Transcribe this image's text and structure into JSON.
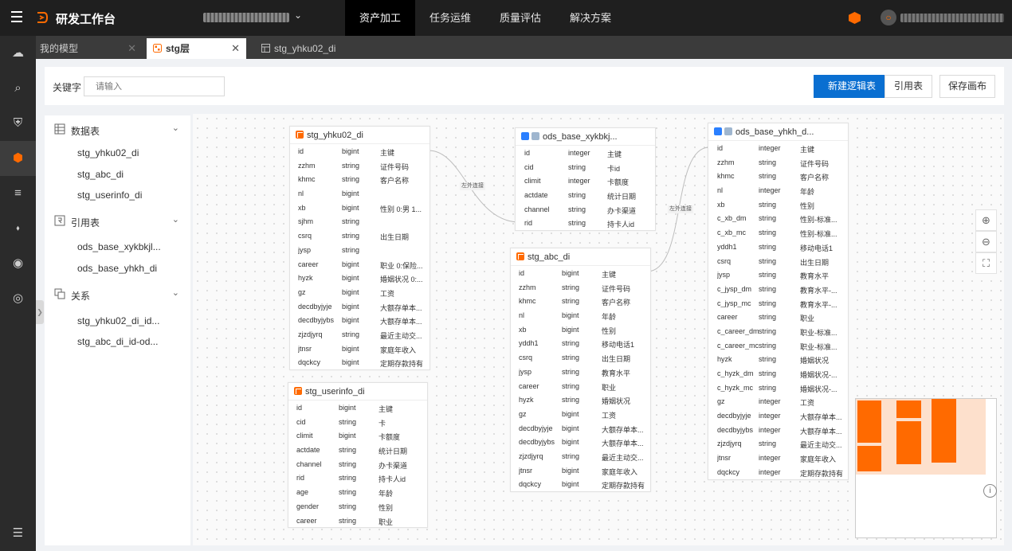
{
  "header": {
    "app_title": "研发工作台",
    "nav": [
      "资产加工",
      "任务运维",
      "质量评估",
      "解决方案"
    ],
    "active_nav": "资产加工"
  },
  "rail_icons": [
    "cloud-icon",
    "search-db-icon",
    "shield-icon",
    "cube-icon",
    "database-icon",
    "tag-icon",
    "api-icon",
    "globe-icon"
  ],
  "tabs": [
    {
      "label": "我的模型"
    },
    {
      "label": "stg层"
    },
    {
      "label": "stg_yhku02_di"
    }
  ],
  "filter": {
    "keyword_label": "关键字",
    "keyword_placeholder": "请输入",
    "btn_new_logic_table": "新建逻辑表",
    "btn_ref_table": "引用表",
    "btn_save_canvas": "保存画布"
  },
  "left_panel": {
    "groups": [
      {
        "label": "数据表",
        "items": [
          "stg_yhku02_di",
          "stg_abc_di",
          "stg_userinfo_di"
        ]
      },
      {
        "label": "引用表",
        "items": [
          "ods_base_xykbkjl...",
          "ods_base_yhkh_di"
        ]
      },
      {
        "label": "关系",
        "items": [
          "stg_yhku02_di_id...",
          "stg_abc_di_id-od..."
        ]
      }
    ]
  },
  "link_label": "左外连接",
  "tables": {
    "t1": {
      "title": "stg_yhku02_di",
      "rows": [
        [
          "id",
          "bigint",
          "主键"
        ],
        [
          "zzhm",
          "string",
          "证件号码"
        ],
        [
          "khmc",
          "string",
          "客户名称"
        ],
        [
          "nl",
          "bigint",
          ""
        ],
        [
          "xb",
          "bigint",
          "性别 0:男 1..."
        ],
        [
          "sjhm",
          "string",
          ""
        ],
        [
          "csrq",
          "string",
          "出生日期"
        ],
        [
          "jysp",
          "string",
          ""
        ],
        [
          "career",
          "bigint",
          "职业 0:保险..."
        ],
        [
          "hyzk",
          "bigint",
          "婚姻状况 0:..."
        ],
        [
          "gz",
          "bigint",
          "工资"
        ],
        [
          "decdbyjyje",
          "bigint",
          "大额存单本..."
        ],
        [
          "decdbyjybs",
          "bigint",
          "大额存单本..."
        ],
        [
          "zjzdjyrq",
          "string",
          "最近主动交..."
        ],
        [
          "jtnsr",
          "bigint",
          "家庭年收入"
        ],
        [
          "dqckcy",
          "bigint",
          "定期存款持有"
        ]
      ]
    },
    "t2": {
      "title": "stg_userinfo_di",
      "rows": [
        [
          "id",
          "bigint",
          "主键"
        ],
        [
          "cid",
          "string",
          "卡"
        ],
        [
          "climit",
          "bigint",
          "卡额度"
        ],
        [
          "actdate",
          "string",
          "统计日期"
        ],
        [
          "channel",
          "string",
          "办卡渠道"
        ],
        [
          "rid",
          "string",
          "持卡人id"
        ],
        [
          "age",
          "string",
          "年龄"
        ],
        [
          "gender",
          "string",
          "性别"
        ],
        [
          "career",
          "string",
          "职业"
        ]
      ]
    },
    "t3": {
      "title": "ods_base_xykbkj...",
      "rows": [
        [
          "id",
          "integer",
          "主键"
        ],
        [
          "cid",
          "string",
          "卡id"
        ],
        [
          "climit",
          "integer",
          "卡额度"
        ],
        [
          "actdate",
          "string",
          "统计日期"
        ],
        [
          "channel",
          "string",
          "办卡渠道"
        ],
        [
          "rid",
          "string",
          "持卡人id"
        ]
      ]
    },
    "t4": {
      "title": "stg_abc_di",
      "rows": [
        [
          "id",
          "bigint",
          "主键"
        ],
        [
          "zzhm",
          "string",
          "证件号码"
        ],
        [
          "khmc",
          "string",
          "客户名称"
        ],
        [
          "nl",
          "bigint",
          "年龄"
        ],
        [
          "xb",
          "bigint",
          "性别"
        ],
        [
          "yddh1",
          "string",
          "移动电话1"
        ],
        [
          "csrq",
          "string",
          "出生日期"
        ],
        [
          "jysp",
          "string",
          "教育水平"
        ],
        [
          "career",
          "string",
          "职业"
        ],
        [
          "hyzk",
          "string",
          "婚姻状况"
        ],
        [
          "gz",
          "bigint",
          "工资"
        ],
        [
          "decdbyjyje",
          "bigint",
          "大额存单本..."
        ],
        [
          "decdbyjybs",
          "bigint",
          "大额存单本..."
        ],
        [
          "zjzdjyrq",
          "string",
          "最近主动交..."
        ],
        [
          "jtnsr",
          "bigint",
          "家庭年收入"
        ],
        [
          "dqckcy",
          "bigint",
          "定期存款持有"
        ]
      ]
    },
    "t5": {
      "title": "ods_base_yhkh_d...",
      "rows": [
        [
          "id",
          "integer",
          "主键"
        ],
        [
          "zzhm",
          "string",
          "证件号码"
        ],
        [
          "khmc",
          "string",
          "客户名称"
        ],
        [
          "nl",
          "integer",
          "年龄"
        ],
        [
          "xb",
          "string",
          "性别"
        ],
        [
          "c_xb_dm",
          "string",
          "性别-标准..."
        ],
        [
          "c_xb_mc",
          "string",
          "性别-标准..."
        ],
        [
          "yddh1",
          "string",
          "移动电话1"
        ],
        [
          "csrq",
          "string",
          "出生日期"
        ],
        [
          "jysp",
          "string",
          "教育水平"
        ],
        [
          "c_jysp_dm",
          "string",
          "教育水平-..."
        ],
        [
          "c_jysp_mc",
          "string",
          "教育水平-..."
        ],
        [
          "career",
          "string",
          "职业"
        ],
        [
          "c_career_dm",
          "string",
          "职业-标准..."
        ],
        [
          "c_career_mc",
          "string",
          "职业-标准..."
        ],
        [
          "hyzk",
          "string",
          "婚姻状况"
        ],
        [
          "c_hyzk_dm",
          "string",
          "婚姻状况-..."
        ],
        [
          "c_hyzk_mc",
          "string",
          "婚姻状况-..."
        ],
        [
          "gz",
          "integer",
          "工资"
        ],
        [
          "decdbyjyje",
          "integer",
          "大额存单本..."
        ],
        [
          "decdbyjybs",
          "integer",
          "大额存单本..."
        ],
        [
          "zjzdjyrq",
          "string",
          "最近主动交..."
        ],
        [
          "jtnsr",
          "integer",
          "家庭年收入"
        ],
        [
          "dqckcy",
          "integer",
          "定期存款持有"
        ]
      ]
    }
  }
}
